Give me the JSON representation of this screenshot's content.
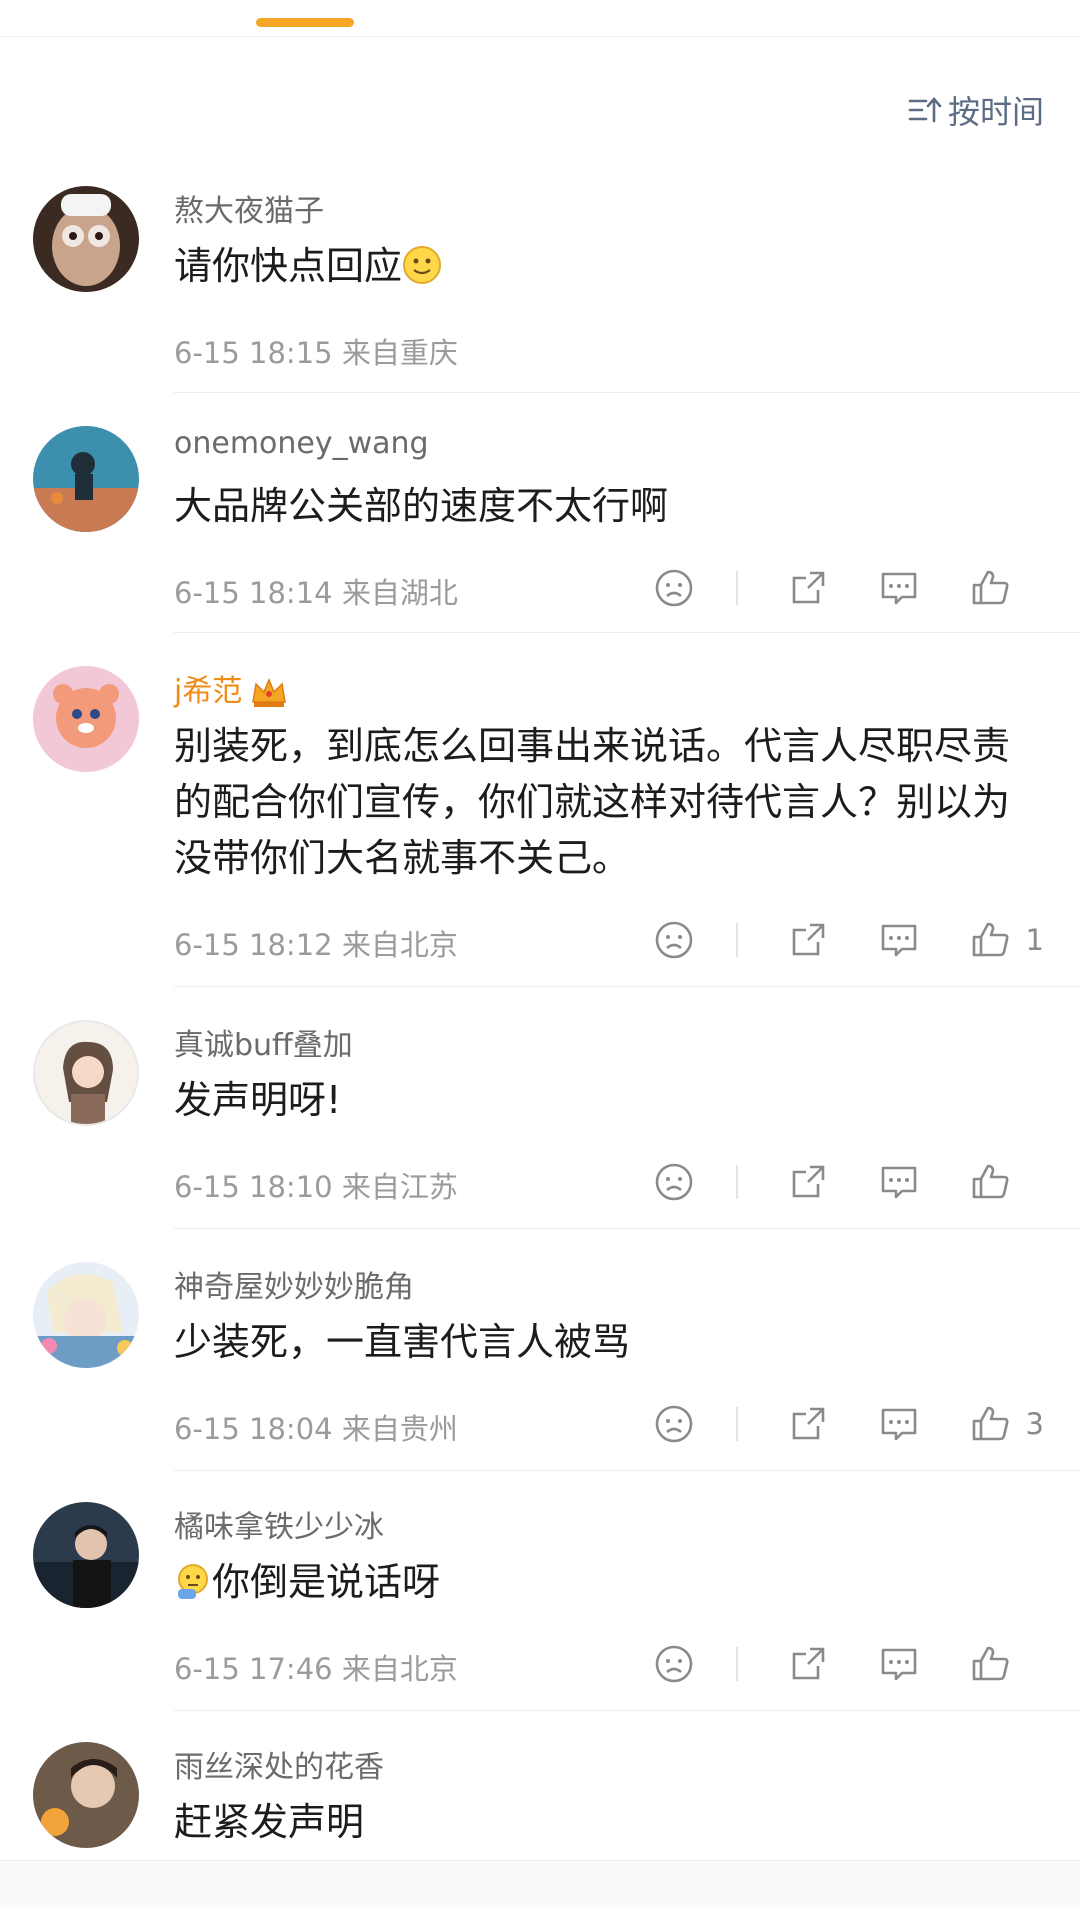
{
  "sort": {
    "label": "按时间",
    "icon": "sort-time-icon"
  },
  "comments": [
    {
      "user": "熬大夜猫子",
      "text": "请你快点回应",
      "text_emoji": "smile-emoji",
      "time": "6-15 18:15",
      "location": "来自重庆",
      "likes": ""
    },
    {
      "user": "onemoney_wang",
      "text": "大品牌公关部的速度不太行啊",
      "time": "6-15 18:14",
      "location": "来自湖北",
      "likes": ""
    },
    {
      "user": "j希范",
      "vip_badge": "crown-icon",
      "text": "别装死，到底怎么回事出来说话。代言人尽职尽责的配合你们宣传，你们就这样对待代言人？别以为没带你们大名就事不关己。",
      "time": "6-15 18:12",
      "location": "来自北京",
      "likes": "1"
    },
    {
      "user": "真诚buff叠加",
      "text": "发声明呀!",
      "time": "6-15 18:10",
      "location": "来自江苏",
      "likes": ""
    },
    {
      "user": "神奇屋妙妙妙脆角",
      "text": "少装死，一直害代言人被骂",
      "time": "6-15 18:04",
      "location": "来自贵州",
      "likes": "3"
    },
    {
      "user": "橘味拿铁少少冰",
      "text": "你倒是说话呀",
      "text_emoji": "thinking-emoji",
      "time": "6-15 17:46",
      "location": "来自北京",
      "likes": ""
    },
    {
      "user": "雨丝深处的花香",
      "text": "赶紧发声明",
      "time": "",
      "location": "",
      "likes": ""
    }
  ],
  "colors": {
    "accent": "#f5a623",
    "link": "#5c6c85",
    "vip": "#f08c18"
  }
}
